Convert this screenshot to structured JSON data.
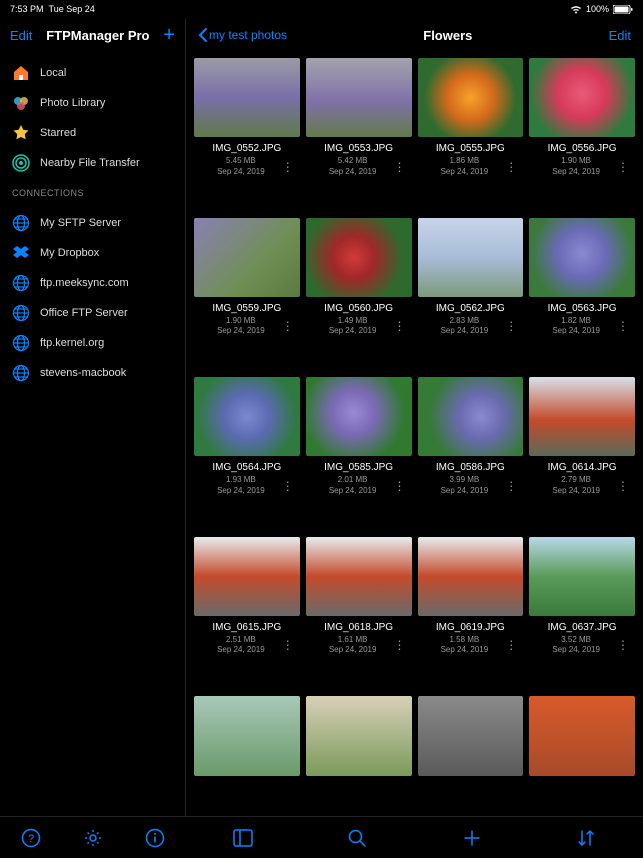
{
  "status": {
    "time": "7:53 PM",
    "date": "Tue Sep 24",
    "battery": "100%"
  },
  "sidebar": {
    "edit": "Edit",
    "title": "FTPManager Pro",
    "locations": [
      {
        "label": "Local",
        "icon": "home"
      },
      {
        "label": "Photo Library",
        "icon": "photos"
      },
      {
        "label": "Starred",
        "icon": "star"
      },
      {
        "label": "Nearby File Transfer",
        "icon": "transfer"
      }
    ],
    "section": "CONNECTIONS",
    "connections": [
      {
        "label": "My SFTP  Server",
        "icon": "globe"
      },
      {
        "label": "My Dropbox",
        "icon": "dropbox"
      },
      {
        "label": "ftp.meeksync.com",
        "icon": "globe"
      },
      {
        "label": "Office FTP Server",
        "icon": "globe"
      },
      {
        "label": "ftp.kernel.org",
        "icon": "globe"
      },
      {
        "label": "stevens-macbook",
        "icon": "globe"
      }
    ]
  },
  "content": {
    "back": "my test photos",
    "title": "Flowers",
    "edit": "Edit",
    "files": [
      {
        "name": "IMG_0552.JPG",
        "size": "5.45 MB",
        "date": "Sep 24, 2019",
        "bg": "linear-gradient(180deg,#9b9ba5 0%,#7a6fa8 50%,#5e7a4a 100%)"
      },
      {
        "name": "IMG_0553.JPG",
        "size": "5.42 MB",
        "date": "Sep 24, 2019",
        "bg": "linear-gradient(180deg,#a3a3ad 0%,#8070a8 55%,#627b4a 100%)"
      },
      {
        "name": "IMG_0555.JPG",
        "size": "1.86 MB",
        "date": "Sep 24, 2019",
        "bg": "radial-gradient(circle at 50% 50%,#f7a32a 0%,#d46a1a 35%,#2f6b2f 70%)"
      },
      {
        "name": "IMG_0556.JPG",
        "size": "1.90 MB",
        "date": "Sep 24, 2019",
        "bg": "radial-gradient(circle at 50% 45%,#e85b7a 0%,#d83a5a 35%,#2f7a3f 75%)"
      },
      {
        "name": "IMG_0559.JPG",
        "size": "1.90 MB",
        "date": "Sep 24, 2019",
        "bg": "linear-gradient(135deg,#8b7fb5 0%,#6f8f55 60%,#5a7a40 100%)"
      },
      {
        "name": "IMG_0560.JPG",
        "size": "1.49 MB",
        "date": "Sep 24, 2019",
        "bg": "radial-gradient(circle at 45% 50%,#d23a3a 0%,#a02828 30%,#2d6a2d 70%)"
      },
      {
        "name": "IMG_0562.JPG",
        "size": "2.83 MB",
        "date": "Sep 24, 2019",
        "bg": "linear-gradient(180deg,#c8d4e8 0%,#a8bcd8 50%,#7a9a7a 100%)"
      },
      {
        "name": "IMG_0563.JPG",
        "size": "1.82 MB",
        "date": "Sep 24, 2019",
        "bg": "radial-gradient(circle at 50% 45%,#8a8ad0 0%,#6a6ab8 35%,#3a7a3a 75%)"
      },
      {
        "name": "IMG_0564.JPG",
        "size": "1.93 MB",
        "date": "Sep 24, 2019",
        "bg": "radial-gradient(circle at 50% 50%,#7a8ad0 0%,#5a6ab0 35%,#2f7a3f 75%)"
      },
      {
        "name": "IMG_0585.JPG",
        "size": "2.01 MB",
        "date": "Sep 24, 2019",
        "bg": "radial-gradient(circle at 45% 45%,#9a8ad5 0%,#7a6ab5 30%,#2f7a2f 70%)"
      },
      {
        "name": "IMG_0586.JPG",
        "size": "3.99 MB",
        "date": "Sep 24, 2019",
        "bg": "radial-gradient(circle at 60% 50%,#8a8ad0 0%,#6a6ab0 30%,#357a35 70%)"
      },
      {
        "name": "IMG_0614.JPG",
        "size": "2.79 MB",
        "date": "Sep 24, 2019",
        "bg": "linear-gradient(180deg,#d8e0ea 0%,#c44a2a 55%,#5a6a5a 100%)"
      },
      {
        "name": "IMG_0615.JPG",
        "size": "2.51 MB",
        "date": "Sep 24, 2019",
        "bg": "linear-gradient(180deg,#e8ecef 0%,#c44a2a 50%,#6a6a6a 100%)"
      },
      {
        "name": "IMG_0618.JPG",
        "size": "1.61 MB",
        "date": "Sep 24, 2019",
        "bg": "linear-gradient(180deg,#e8ecef 0%,#c44a2a 50%,#6a6a6a 100%)"
      },
      {
        "name": "IMG_0619.JPG",
        "size": "1.58 MB",
        "date": "Sep 24, 2019",
        "bg": "linear-gradient(180deg,#e8ecef 0%,#c44a2a 50%,#6a6a6a 100%)"
      },
      {
        "name": "IMG_0637.JPG",
        "size": "3.52 MB",
        "date": "Sep 24, 2019",
        "bg": "linear-gradient(180deg,#b8d8e8 0%,#5a9a5a 50%,#3a7a3a 100%)"
      },
      {
        "name": "",
        "size": "",
        "date": "",
        "bg": "linear-gradient(180deg,#a8c8b8 0%,#6a9a6a 100%)"
      },
      {
        "name": "",
        "size": "",
        "date": "",
        "bg": "linear-gradient(180deg,#d8d0b8 0%,#7a9a5a 100%)"
      },
      {
        "name": "",
        "size": "",
        "date": "",
        "bg": "linear-gradient(180deg,#8a8a8a 0%,#5a5a5a 100%)"
      },
      {
        "name": "",
        "size": "",
        "date": "",
        "bg": "linear-gradient(180deg,#d85a2a 0%,#a84a2a 100%)"
      }
    ]
  }
}
